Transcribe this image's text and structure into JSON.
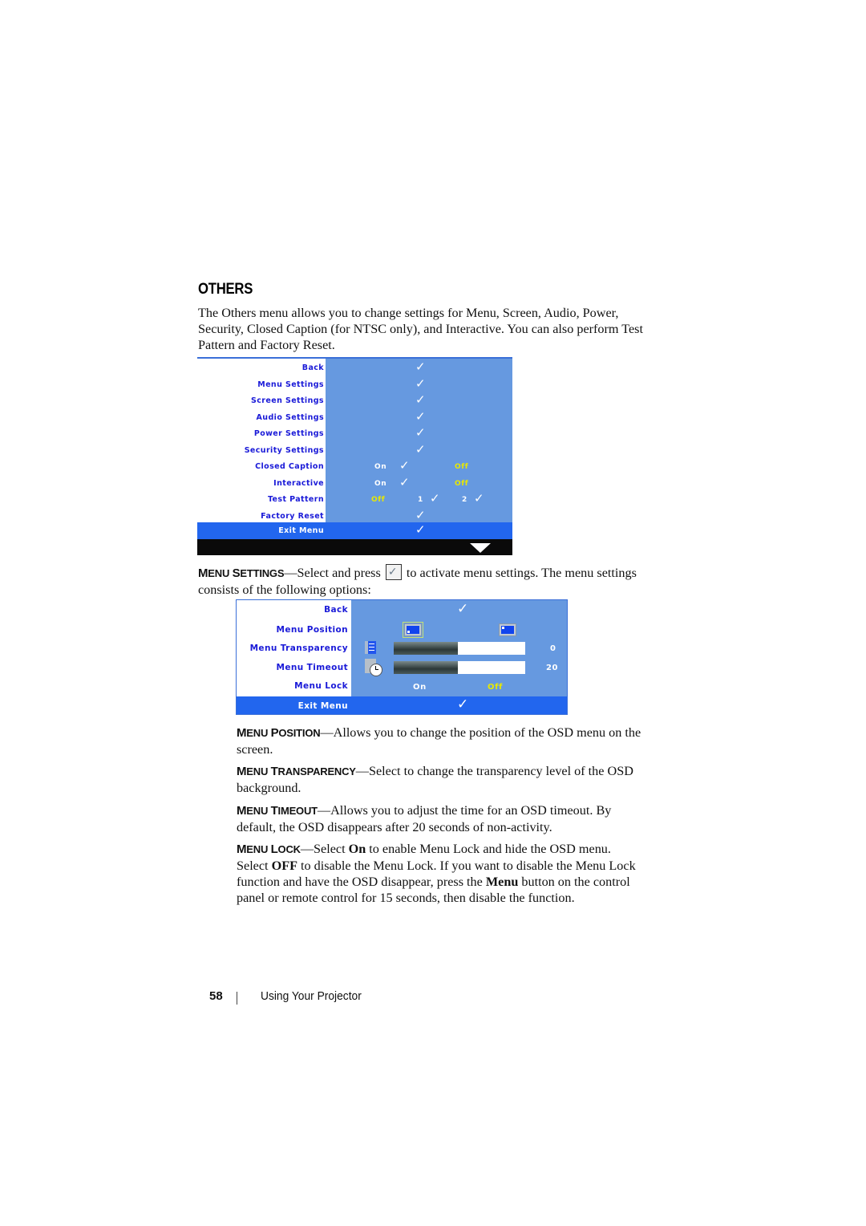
{
  "section": {
    "heading": "Others",
    "intro": "The Others menu allows you to change settings for Menu, Screen, Audio, Power, Security, Closed Caption (for NTSC only), and Interactive. You can also perform Test Pattern and Factory Reset."
  },
  "others_menu": {
    "colors": {
      "panel": "#6699e0",
      "label": "#1a1ad8",
      "selected_bar": "#2266ee",
      "yellow_value": "#e8e800",
      "footer_bar": "#0a0a0a"
    },
    "rows": [
      {
        "label": "Back",
        "check": "✓"
      },
      {
        "label": "Menu Settings",
        "check": "✓"
      },
      {
        "label": "Screen Settings",
        "check": "✓"
      },
      {
        "label": "Audio Settings",
        "check": "✓"
      },
      {
        "label": "Power Settings",
        "check": "✓"
      },
      {
        "label": "Security Settings",
        "check": "✓"
      },
      {
        "label": "Closed Caption",
        "opt1": "On",
        "check": "✓",
        "opt2": "Off"
      },
      {
        "label": "Interactive",
        "opt1": "On",
        "check": "✓",
        "opt2": "Off"
      },
      {
        "label": "Test Pattern",
        "opt1": "Off",
        "opt2": "1",
        "check2": "✓",
        "opt3": "2",
        "check3": "✓"
      },
      {
        "label": "Factory Reset",
        "check": "✓"
      }
    ],
    "exit": {
      "label": "Exit Menu",
      "check": "✓"
    },
    "scroll_icon": "down-triangle-icon"
  },
  "menu_settings_para": {
    "term_first": "M",
    "term_rest": "ENU ",
    "term2_first": "S",
    "term2_rest": "ETTINGS",
    "dash": "—",
    "text_before_icon": "Select and press ",
    "icon": "checkmark-button-icon",
    "text_after_icon": " to activate menu settings. The menu settings consists of the following options:"
  },
  "menu_settings": {
    "rows": {
      "back": {
        "label": "Back",
        "check": "✓"
      },
      "position": {
        "label": "Menu Position",
        "selected": "bottom-left",
        "options": [
          "bottom-left",
          "top-left"
        ]
      },
      "transparency": {
        "label": "Menu Transparency",
        "value": "0",
        "fill_fraction": 0.49
      },
      "timeout": {
        "label": "Menu Timeout",
        "value": "20",
        "fill_fraction": 0.49
      },
      "lock": {
        "label": "Menu Lock",
        "opt1": "On",
        "opt2": "Off"
      }
    },
    "exit": {
      "label": "Exit Menu",
      "check": "✓"
    }
  },
  "descriptions": [
    {
      "term_a": "M",
      "term_b": "ENU ",
      "term_c": "P",
      "term_d": "OSITION",
      "text": "—Allows you to change the position of the OSD menu on the screen."
    },
    {
      "term_a": "M",
      "term_b": "ENU ",
      "term_c": "T",
      "term_d": "RANSPARENCY",
      "text": "—Select to change the transparency level of the OSD background."
    },
    {
      "term_a": "M",
      "term_b": "ENU ",
      "term_c": "T",
      "term_d": "IMEOUT",
      "text": "—Allows you to adjust the time for an OSD timeout. By default, the OSD disappears after 20 seconds of non-activity."
    },
    {
      "term_a": "M",
      "term_b": "ENU ",
      "term_c": "L",
      "term_d": "OCK",
      "text1": "—Select ",
      "bold1": "On",
      "text2": " to enable Menu Lock and hide the OSD menu. Select ",
      "bold2": "OFF",
      "text3": " to disable the Menu Lock. If you want to disable the Menu Lock function and have the OSD disappear, press the ",
      "bold3": "Menu",
      "text4": " button on the control panel or remote control for 15 seconds, then disable the function."
    }
  ],
  "footer": {
    "page_number": "58",
    "chapter": "Using Your Projector"
  }
}
